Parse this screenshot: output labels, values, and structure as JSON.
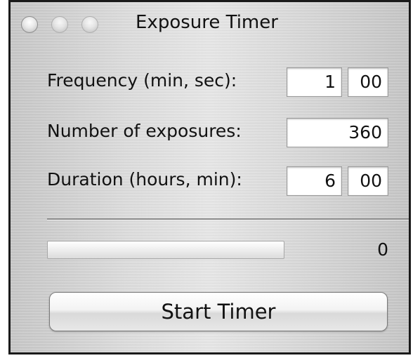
{
  "window": {
    "title": "Exposure Timer"
  },
  "form": {
    "frequency": {
      "label": "Frequency (min, sec):",
      "minutes": "1",
      "seconds": "00"
    },
    "exposures": {
      "label": "Number of exposures:",
      "value": "360"
    },
    "duration": {
      "label": "Duration (hours, min):",
      "hours": "6",
      "minutes": "00"
    }
  },
  "progress": {
    "fraction": 0,
    "count": "0"
  },
  "actions": {
    "start_label": "Start Timer"
  }
}
